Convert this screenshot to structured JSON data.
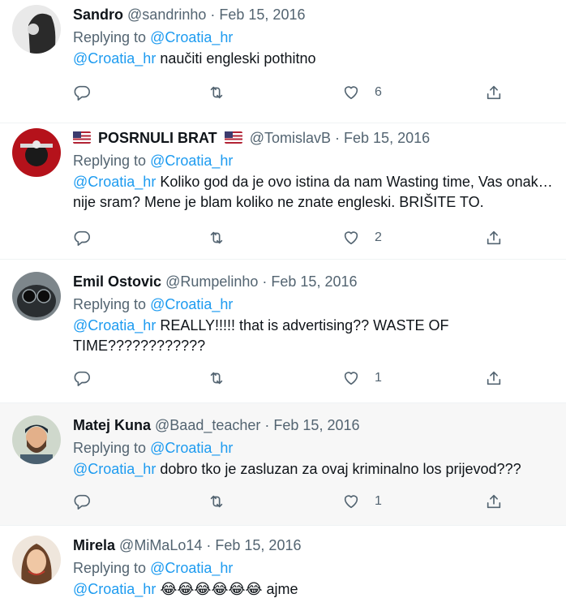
{
  "tweets": [
    {
      "name": "Sandro",
      "handle": "@sandrinho",
      "date": "Feb 15, 2016",
      "replying_label": "Replying to",
      "replying_to": "@Croatia_hr",
      "mention": "@Croatia_hr",
      "text": "naučiti engleski pothitno",
      "likes": "6",
      "avatar_colors": [
        "#e8e8e8",
        "#2b2b2b"
      ]
    },
    {
      "name": "POSRNULI BRAT",
      "handle": "@TomislavB",
      "date": "Feb 15, 2016",
      "replying_label": "Replying to",
      "replying_to": "@Croatia_hr",
      "mention": "@Croatia_hr",
      "text": "Koliko god da je ovo istina da nam Wasting time, Vas onak… nije sram? Mene je blam koliko ne znate engleski. BRIŠITE TO.",
      "likes": "2",
      "avatar_colors": [
        "#b5121b",
        "#1a1a1a"
      ]
    },
    {
      "name": "Emil Ostovic",
      "handle": "@Rumpelinho",
      "date": "Feb 15, 2016",
      "replying_label": "Replying to",
      "replying_to": "@Croatia_hr",
      "mention": "@Croatia_hr",
      "text": "REALLY!!!!! that is advertising?? WASTE OF TIME????????????",
      "likes": "1",
      "avatar_colors": [
        "#6e7a80",
        "#1f2326"
      ]
    },
    {
      "name": "Matej Kuna",
      "handle": "@Baad_teacher",
      "date": "Feb 15, 2016",
      "replying_label": "Replying to",
      "replying_to": "@Croatia_hr",
      "mention": "@Croatia_hr",
      "text": "dobro tko je zasluzan za ovaj kriminalno los prijevod???",
      "likes": "1",
      "avatar_colors": [
        "#c9d3c4",
        "#4a3a2c"
      ]
    },
    {
      "name": "Mirela",
      "handle": "@MiMaLo14",
      "date": "Feb 15, 2016",
      "replying_label": "Replying to",
      "replying_to": "@Croatia_hr",
      "mention": "@Croatia_hr",
      "text": "😂😂😂😂😂😂 ajme",
      "likes": "",
      "avatar_colors": [
        "#e9c9a8",
        "#5a3a22"
      ]
    }
  ],
  "flag_icon": "us-flag-icon",
  "colors": {
    "link": "#1d9bf0",
    "muted": "#536471",
    "hover_bg": "#f7f7f7"
  }
}
